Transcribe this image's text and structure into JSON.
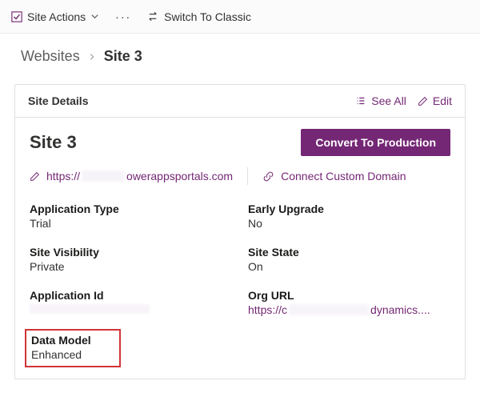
{
  "ribbon": {
    "site_actions_label": "Site Actions",
    "switch_classic_label": "Switch To Classic"
  },
  "breadcrumb": {
    "parent": "Websites",
    "current": "Site 3"
  },
  "card": {
    "header_title": "Site Details",
    "see_all_label": "See All",
    "edit_label": "Edit"
  },
  "site": {
    "name": "Site 3",
    "convert_button": "Convert To Production",
    "url_prefix": "https://",
    "url_suffix": "owerappsportals.com",
    "connect_domain_label": "Connect Custom Domain"
  },
  "fields": {
    "application_type": {
      "label": "Application Type",
      "value": "Trial"
    },
    "early_upgrade": {
      "label": "Early Upgrade",
      "value": "No"
    },
    "site_visibility": {
      "label": "Site Visibility",
      "value": "Private"
    },
    "site_state": {
      "label": "Site State",
      "value": "On"
    },
    "application_id": {
      "label": "Application Id",
      "value": ""
    },
    "org_url": {
      "label": "Org URL",
      "prefix": "https://c",
      "suffix": "dynamics...."
    },
    "data_model": {
      "label": "Data Model",
      "value": "Enhanced"
    }
  },
  "colors": {
    "accent": "#742774",
    "danger": "#d13438"
  }
}
